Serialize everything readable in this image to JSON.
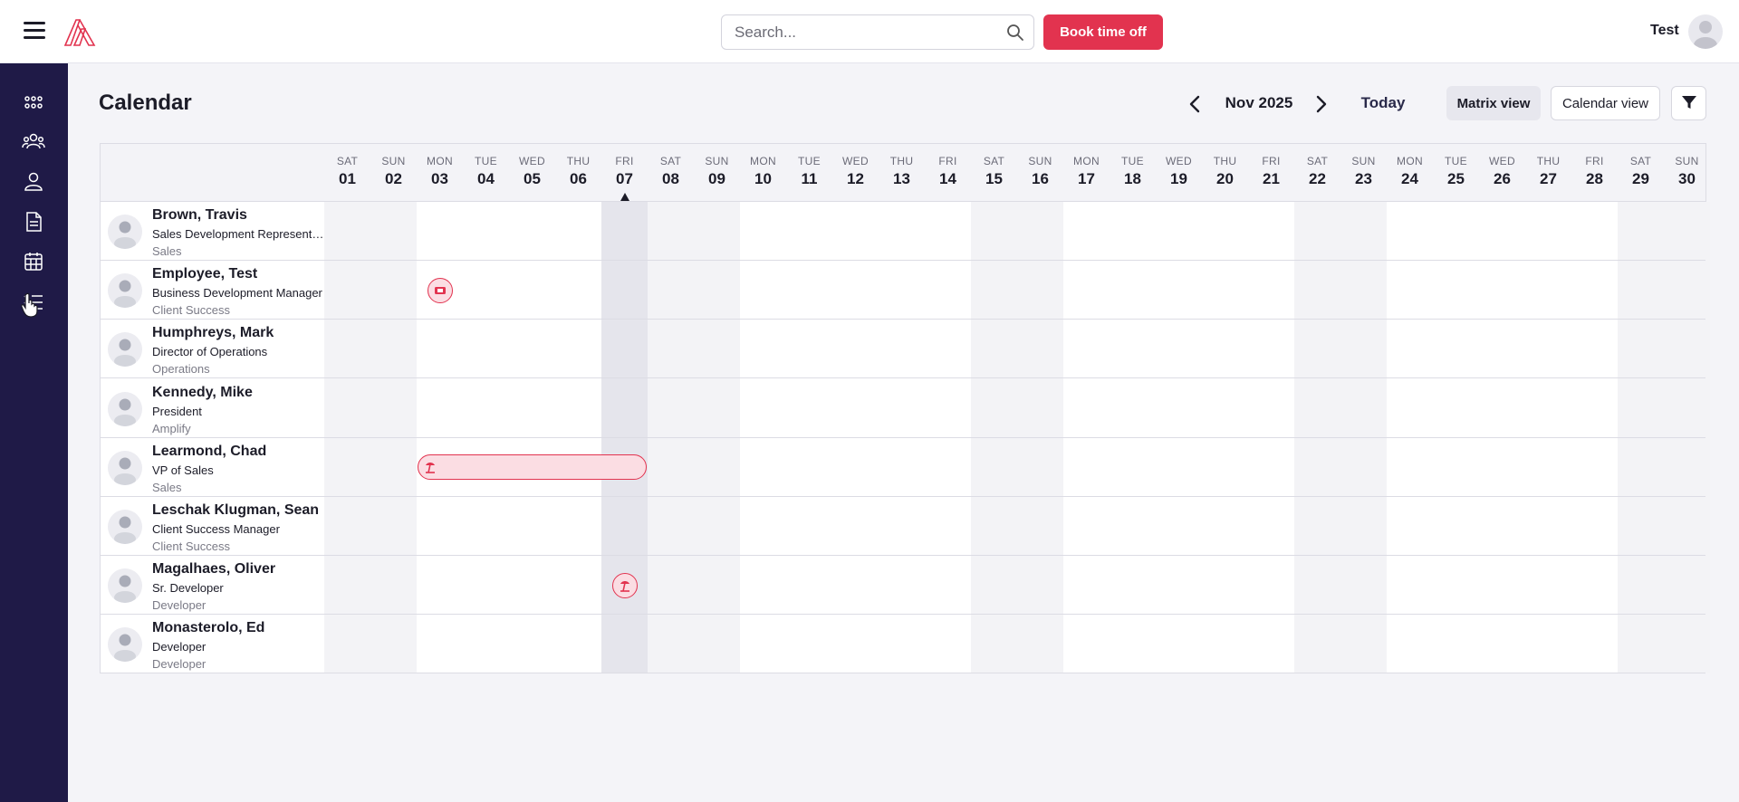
{
  "header": {
    "search_placeholder": "Search...",
    "book_label": "Book time off",
    "user_name": "Test"
  },
  "page": {
    "title": "Calendar",
    "month": "Nov 2025",
    "today_label": "Today",
    "matrix_view_label": "Matrix view",
    "calendar_view_label": "Calendar view"
  },
  "sidebar": {
    "items": [
      {
        "icon": "dashboard-icon"
      },
      {
        "icon": "team-icon"
      },
      {
        "icon": "person-icon"
      },
      {
        "icon": "document-icon"
      },
      {
        "icon": "calendar-icon"
      },
      {
        "icon": "checklist-icon"
      }
    ]
  },
  "days": [
    {
      "dow": "SAT",
      "num": "01"
    },
    {
      "dow": "SUN",
      "num": "02"
    },
    {
      "dow": "MON",
      "num": "03"
    },
    {
      "dow": "TUE",
      "num": "04"
    },
    {
      "dow": "WED",
      "num": "05"
    },
    {
      "dow": "THU",
      "num": "06"
    },
    {
      "dow": "FRI",
      "num": "07"
    },
    {
      "dow": "SAT",
      "num": "08"
    },
    {
      "dow": "SUN",
      "num": "09"
    },
    {
      "dow": "MON",
      "num": "10"
    },
    {
      "dow": "TUE",
      "num": "11"
    },
    {
      "dow": "WED",
      "num": "12"
    },
    {
      "dow": "THU",
      "num": "13"
    },
    {
      "dow": "FRI",
      "num": "14"
    },
    {
      "dow": "SAT",
      "num": "15"
    },
    {
      "dow": "SUN",
      "num": "16"
    },
    {
      "dow": "MON",
      "num": "17"
    },
    {
      "dow": "TUE",
      "num": "18"
    },
    {
      "dow": "WED",
      "num": "19"
    },
    {
      "dow": "THU",
      "num": "20"
    },
    {
      "dow": "FRI",
      "num": "21"
    },
    {
      "dow": "SAT",
      "num": "22"
    },
    {
      "dow": "SUN",
      "num": "23"
    },
    {
      "dow": "MON",
      "num": "24"
    },
    {
      "dow": "TUE",
      "num": "25"
    },
    {
      "dow": "WED",
      "num": "26"
    },
    {
      "dow": "THU",
      "num": "27"
    },
    {
      "dow": "FRI",
      "num": "28"
    },
    {
      "dow": "SAT",
      "num": "29"
    },
    {
      "dow": "SUN",
      "num": "30"
    }
  ],
  "today_day": "07",
  "employees": [
    {
      "name": "Brown, Travis",
      "title": "Sales Development Representative",
      "dept": "Sales"
    },
    {
      "name": "Employee, Test",
      "title": "Business Development Manager",
      "dept": "Client Success"
    },
    {
      "name": "Humphreys, Mark",
      "title": "Director of Operations",
      "dept": "Operations"
    },
    {
      "name": "Kennedy, Mike",
      "title": "President",
      "dept": "Amplify"
    },
    {
      "name": "Learmond, Chad",
      "title": "VP of Sales",
      "dept": "Sales"
    },
    {
      "name": "Leschak Klugman, Sean",
      "title": "Client Success Manager",
      "dept": "Client Success"
    },
    {
      "name": "Magalhaes, Oliver",
      "title": "Sr. Developer",
      "dept": "Developer"
    },
    {
      "name": "Monasterolo, Ed",
      "title": "Developer",
      "dept": "Developer"
    }
  ],
  "events": [
    {
      "employee": "Employee, Test",
      "start_day": "03",
      "end_day": "03",
      "icon": "ticket-icon"
    },
    {
      "employee": "Learmond, Chad",
      "start_day": "03",
      "end_day": "07",
      "icon": "beach-icon"
    },
    {
      "employee": "Magalhaes, Oliver",
      "start_day": "07",
      "end_day": "07",
      "icon": "beach-icon"
    }
  ],
  "colors": {
    "accent": "#e2334f",
    "sidebar": "#1f1a47",
    "event_fill": "#fbdde3"
  }
}
